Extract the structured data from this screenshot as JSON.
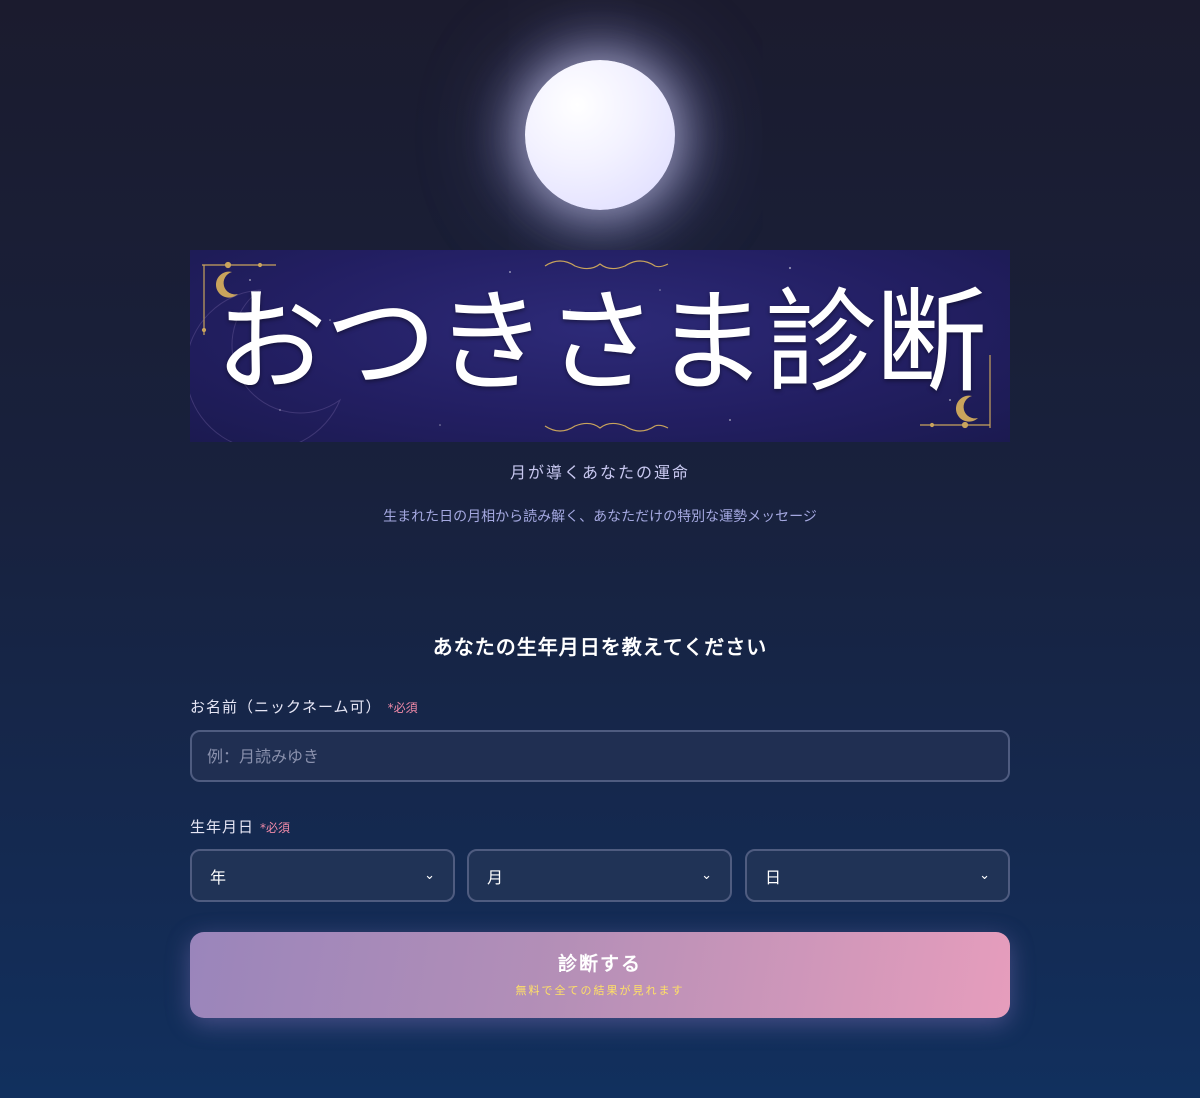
{
  "header": {
    "banner_title": "おつきさま診断",
    "tagline": "月が導くあなたの運命",
    "subtext": "生まれた日の月相から読み解く、あなただけの特別な運勢メッセージ"
  },
  "form": {
    "title": "あなたの生年月日を教えてください",
    "name_label": "お名前（ニックネーム可）",
    "required_mark": "*必須",
    "name_placeholder": "例：月読みゆき",
    "dob_label": "生年月日",
    "year_select": "年",
    "month_select": "月",
    "day_select": "日",
    "submit_label": "診断する",
    "submit_note": "無料で全ての結果が見れます"
  },
  "colors": {
    "background_top": "#1b1b2e",
    "background_bottom": "#11305e",
    "banner": "#231f63",
    "gold_ornament": "#c9a45c",
    "required": "#f08aa8",
    "submit_gradient_start": "#9a85bb",
    "submit_gradient_end": "#e69dbc",
    "submit_note": "#ffe066"
  },
  "icons": {
    "moon": "full-moon",
    "crescent": "crescent-moon-icon",
    "select_arrow": "chevron-down-icon"
  }
}
